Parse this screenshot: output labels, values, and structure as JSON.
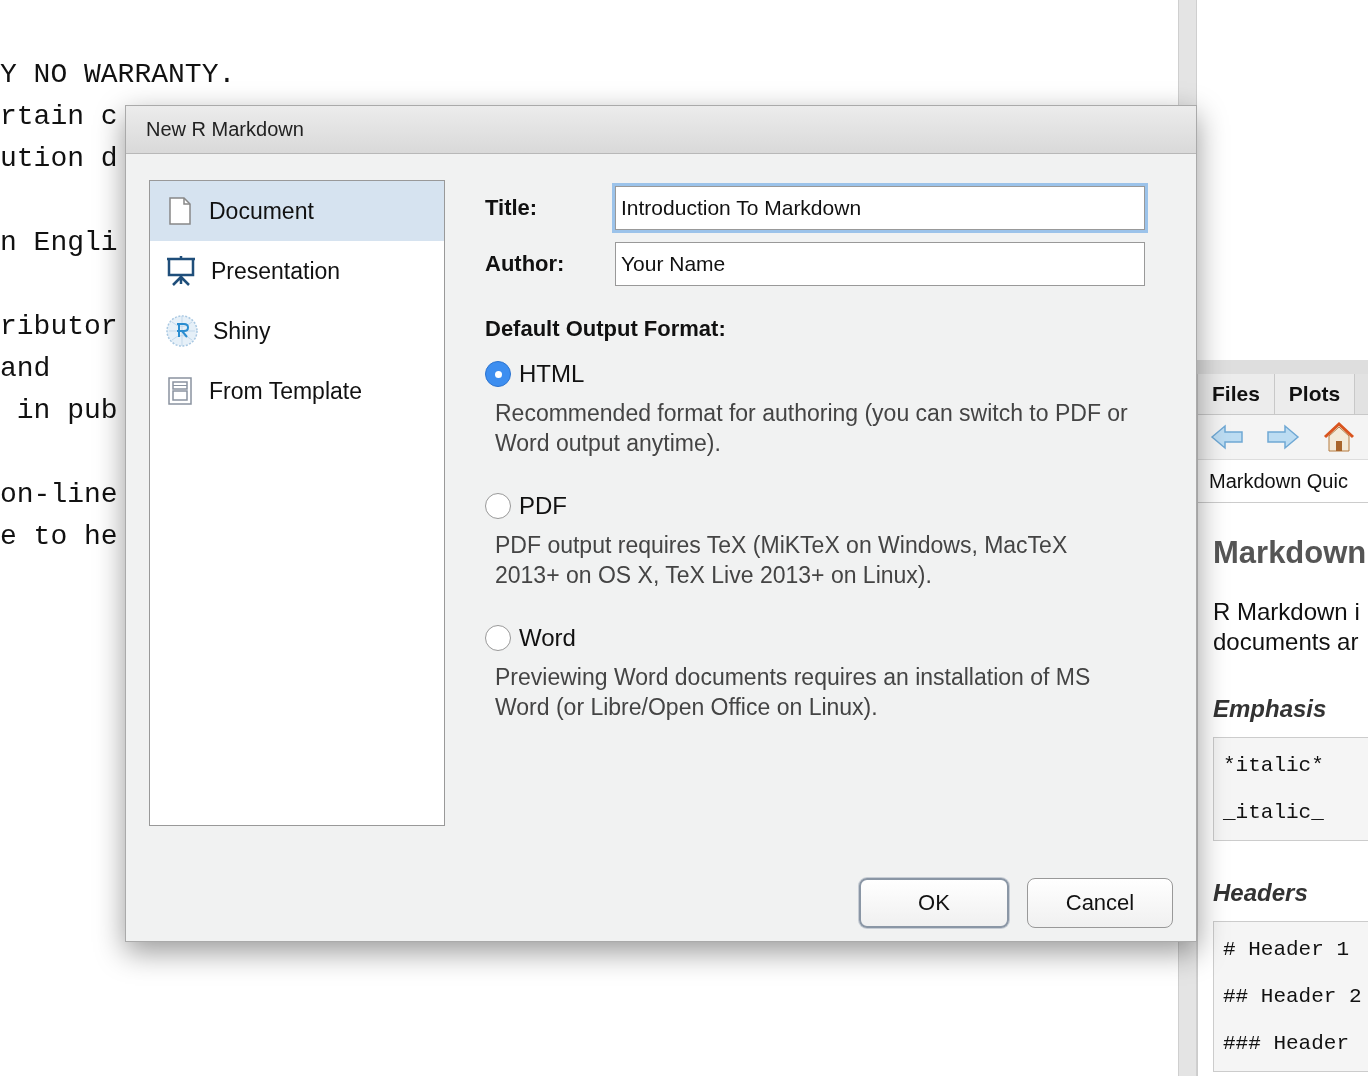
{
  "editor": {
    "paragraphs": [
      [
        "Y NO WARRANTY.",
        "rtain c",
        "ution d"
      ],
      [
        "n Engli"
      ],
      [
        "ributor",
        "and",
        " in pub"
      ],
      [
        "on-line",
        "e to he"
      ]
    ]
  },
  "help_pane": {
    "tabs": [
      {
        "label": "Files"
      },
      {
        "label": "Plots"
      }
    ],
    "location": "Markdown Quic",
    "heading": "Markdown",
    "intro_lines": [
      "R Markdown i",
      "documents ar"
    ],
    "sections": [
      {
        "title": "Emphasis",
        "code_lines": [
          "*italic*",
          "_italic_"
        ]
      },
      {
        "title": "Headers",
        "code_lines": [
          "# Header 1",
          "## Header 2",
          "### Header"
        ]
      }
    ]
  },
  "dialog": {
    "title": "New R Markdown",
    "types": [
      {
        "label": "Document",
        "kind": "document",
        "selected": true
      },
      {
        "label": "Presentation",
        "kind": "presentation",
        "selected": false
      },
      {
        "label": "Shiny",
        "kind": "shiny",
        "selected": false
      },
      {
        "label": "From Template",
        "kind": "template",
        "selected": false
      }
    ],
    "fields": [
      {
        "label": "Title:",
        "value": "Introduction To Markdown",
        "focused": true
      },
      {
        "label": "Author:",
        "value": "Your Name",
        "focused": false
      }
    ],
    "format_heading": "Default Output Format:",
    "formats": [
      {
        "label": "HTML",
        "selected": true,
        "description": "Recommended format for authoring (you can switch to PDF or Word output anytime)."
      },
      {
        "label": "PDF",
        "selected": false,
        "description": "PDF output requires TeX (MiKTeX on Windows, MacTeX 2013+ on OS X, TeX Live 2013+ on Linux)."
      },
      {
        "label": "Word",
        "selected": false,
        "description": "Previewing Word documents requires an installation of MS Word (or Libre/Open Office on Linux)."
      }
    ],
    "buttons": [
      {
        "label": "OK",
        "default": true
      },
      {
        "label": "Cancel",
        "default": false
      }
    ]
  }
}
